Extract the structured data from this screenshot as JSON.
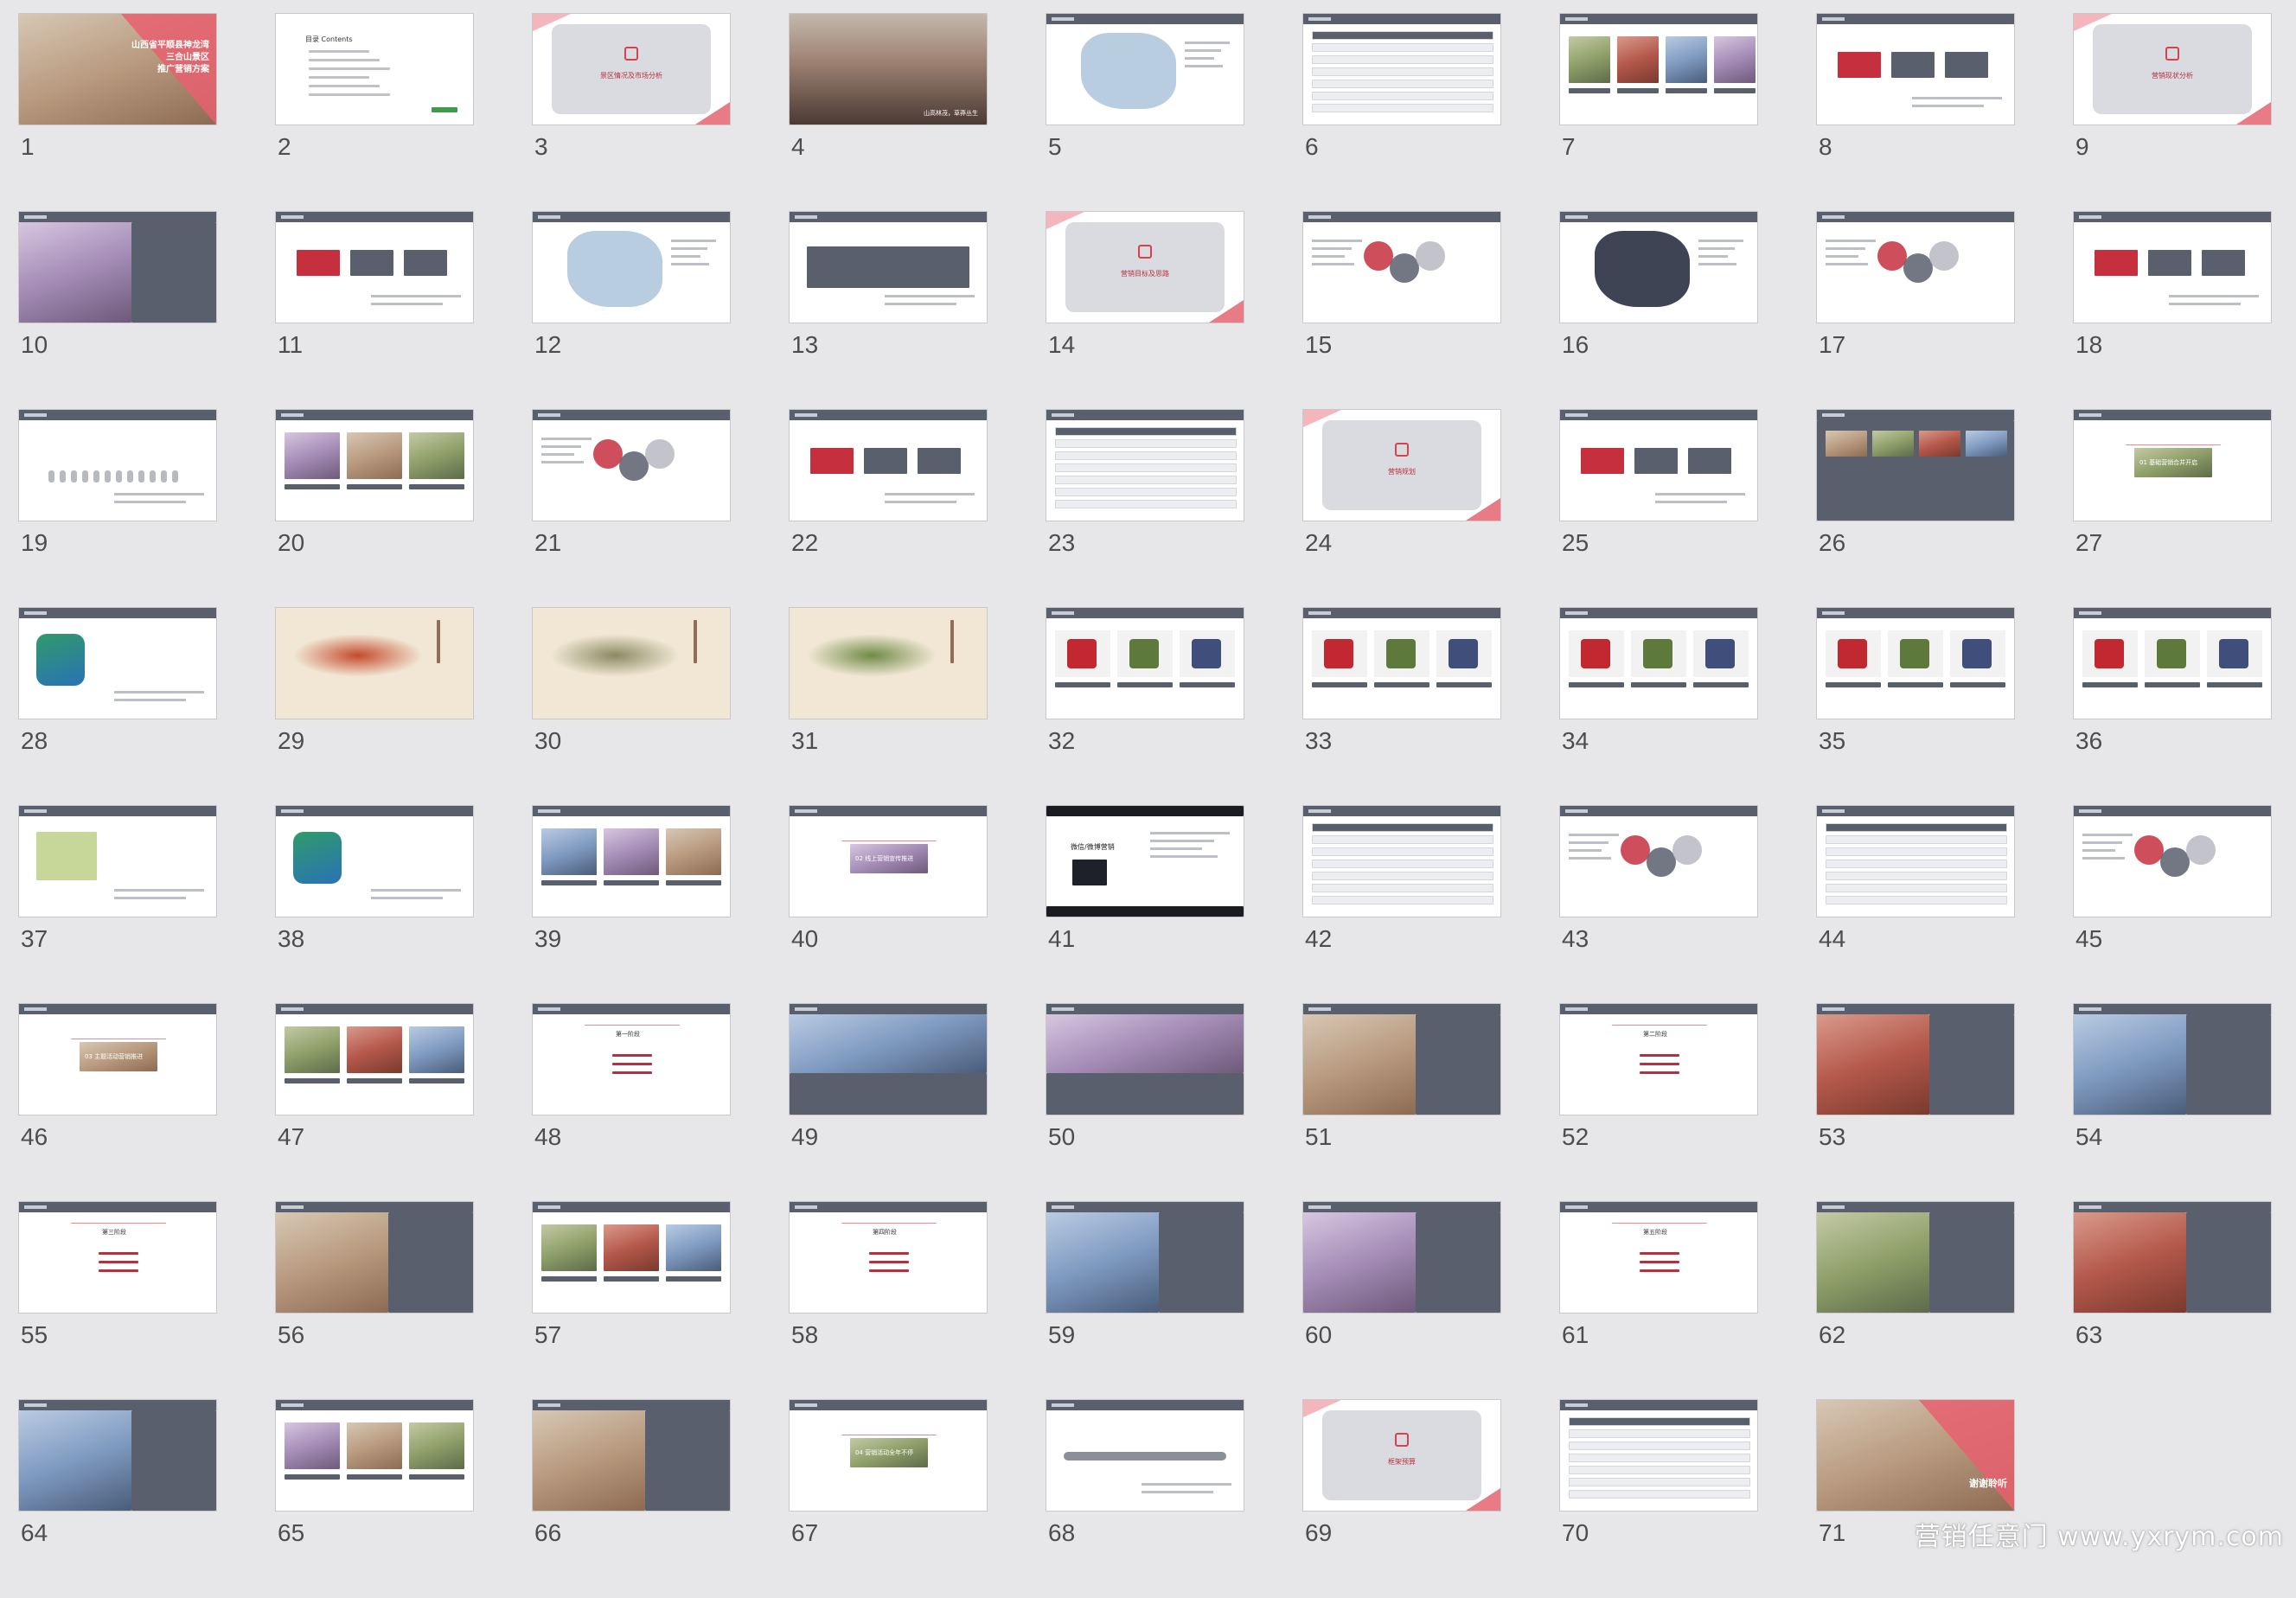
{
  "watermark": "营销任意门 www.yxrym.com",
  "slides": [
    {
      "n": "1",
      "kind": "title",
      "title_lines": [
        "山西省平顺县神龙湾",
        "三合山景区",
        "推广营销方案"
      ]
    },
    {
      "n": "2",
      "kind": "toc",
      "toc_title": "目录 Contents"
    },
    {
      "n": "3",
      "kind": "section",
      "section": "景区情况及市场分析"
    },
    {
      "n": "4",
      "kind": "photo",
      "caption": "山高林茂，草莽丛生"
    },
    {
      "n": "5",
      "kind": "map"
    },
    {
      "n": "6",
      "kind": "rows"
    },
    {
      "n": "7",
      "kind": "photos4"
    },
    {
      "n": "8",
      "kind": "swot"
    },
    {
      "n": "9",
      "kind": "section",
      "section": "营销现状分析"
    },
    {
      "n": "10",
      "kind": "photo-left"
    },
    {
      "n": "11",
      "kind": "boxes"
    },
    {
      "n": "12",
      "kind": "map-table"
    },
    {
      "n": "13",
      "kind": "panel"
    },
    {
      "n": "14",
      "kind": "section",
      "section": "营销目标及思路"
    },
    {
      "n": "15",
      "kind": "venn"
    },
    {
      "n": "16",
      "kind": "chinamap"
    },
    {
      "n": "17",
      "kind": "cycle"
    },
    {
      "n": "18",
      "kind": "slope"
    },
    {
      "n": "19",
      "kind": "people"
    },
    {
      "n": "20",
      "kind": "photo3"
    },
    {
      "n": "21",
      "kind": "hex"
    },
    {
      "n": "22",
      "kind": "flow"
    },
    {
      "n": "23",
      "kind": "table"
    },
    {
      "n": "24",
      "kind": "section",
      "section": "营销规划"
    },
    {
      "n": "25",
      "kind": "diagram"
    },
    {
      "n": "26",
      "kind": "darkphotos"
    },
    {
      "n": "27",
      "kind": "banner",
      "banner": "01 基础营销合并开启"
    },
    {
      "n": "28",
      "kind": "logo"
    },
    {
      "n": "29",
      "kind": "ink"
    },
    {
      "n": "30",
      "kind": "ink"
    },
    {
      "n": "31",
      "kind": "ink"
    },
    {
      "n": "32",
      "kind": "products"
    },
    {
      "n": "33",
      "kind": "products"
    },
    {
      "n": "34",
      "kind": "products"
    },
    {
      "n": "35",
      "kind": "products"
    },
    {
      "n": "36",
      "kind": "products"
    },
    {
      "n": "37",
      "kind": "package"
    },
    {
      "n": "38",
      "kind": "logo2"
    },
    {
      "n": "39",
      "kind": "photo-circles"
    },
    {
      "n": "40",
      "kind": "banner",
      "banner": "02 线上营销宣传推进"
    },
    {
      "n": "41",
      "kind": "dark",
      "title": "微信/微博营销"
    },
    {
      "n": "42",
      "kind": "grid-icons"
    },
    {
      "n": "43",
      "kind": "network"
    },
    {
      "n": "44",
      "kind": "logos"
    },
    {
      "n": "45",
      "kind": "hub"
    },
    {
      "n": "46",
      "kind": "banner",
      "banner": "03 主题活动营销推进"
    },
    {
      "n": "47",
      "kind": "collage"
    },
    {
      "n": "48",
      "kind": "stage",
      "title": "第一阶段"
    },
    {
      "n": "49",
      "kind": "bigphoto"
    },
    {
      "n": "50",
      "kind": "bigphoto"
    },
    {
      "n": "51",
      "kind": "photo-text"
    },
    {
      "n": "52",
      "kind": "stage",
      "title": "第二阶段"
    },
    {
      "n": "53",
      "kind": "photo-text"
    },
    {
      "n": "54",
      "kind": "photo-text"
    },
    {
      "n": "55",
      "kind": "stage",
      "title": "第三阶段"
    },
    {
      "n": "56",
      "kind": "photo-text"
    },
    {
      "n": "57",
      "kind": "photo3b"
    },
    {
      "n": "58",
      "kind": "stage",
      "title": "第四阶段"
    },
    {
      "n": "59",
      "kind": "photo-text"
    },
    {
      "n": "60",
      "kind": "photo-text"
    },
    {
      "n": "61",
      "kind": "stage",
      "title": "第五阶段"
    },
    {
      "n": "62",
      "kind": "photo-text"
    },
    {
      "n": "63",
      "kind": "photo-text"
    },
    {
      "n": "64",
      "kind": "photo-text"
    },
    {
      "n": "65",
      "kind": "photo3b"
    },
    {
      "n": "66",
      "kind": "photo-text"
    },
    {
      "n": "67",
      "kind": "banner",
      "banner": "04 营销活动全年不停"
    },
    {
      "n": "68",
      "kind": "road"
    },
    {
      "n": "69",
      "kind": "section",
      "section": "框架预算"
    },
    {
      "n": "70",
      "kind": "table"
    },
    {
      "n": "71",
      "kind": "end",
      "title": "谢谢聆听"
    }
  ]
}
